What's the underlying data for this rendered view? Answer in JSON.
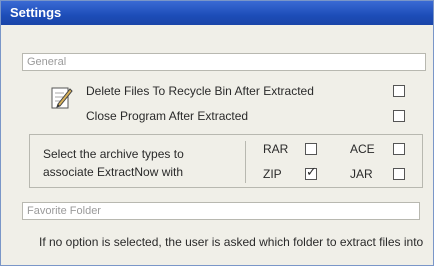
{
  "window": {
    "title": "Settings"
  },
  "general": {
    "header": "General",
    "options": [
      {
        "label": "Delete Files To Recycle Bin After Extracted",
        "checked": false
      },
      {
        "label": "Close Program After Extracted",
        "checked": false
      }
    ]
  },
  "associate": {
    "description": "Select the archive types to associate ExtractNow with",
    "types": [
      {
        "label": "RAR",
        "checked": false
      },
      {
        "label": "ACE",
        "checked": false
      },
      {
        "label": "ZIP",
        "checked": true
      },
      {
        "label": "JAR",
        "checked": false
      }
    ]
  },
  "favorite": {
    "header": "Favorite Folder",
    "info": "If no option is selected, the user is asked which folder to extract files into"
  },
  "icons": {
    "edit": "pencil-note-icon"
  }
}
